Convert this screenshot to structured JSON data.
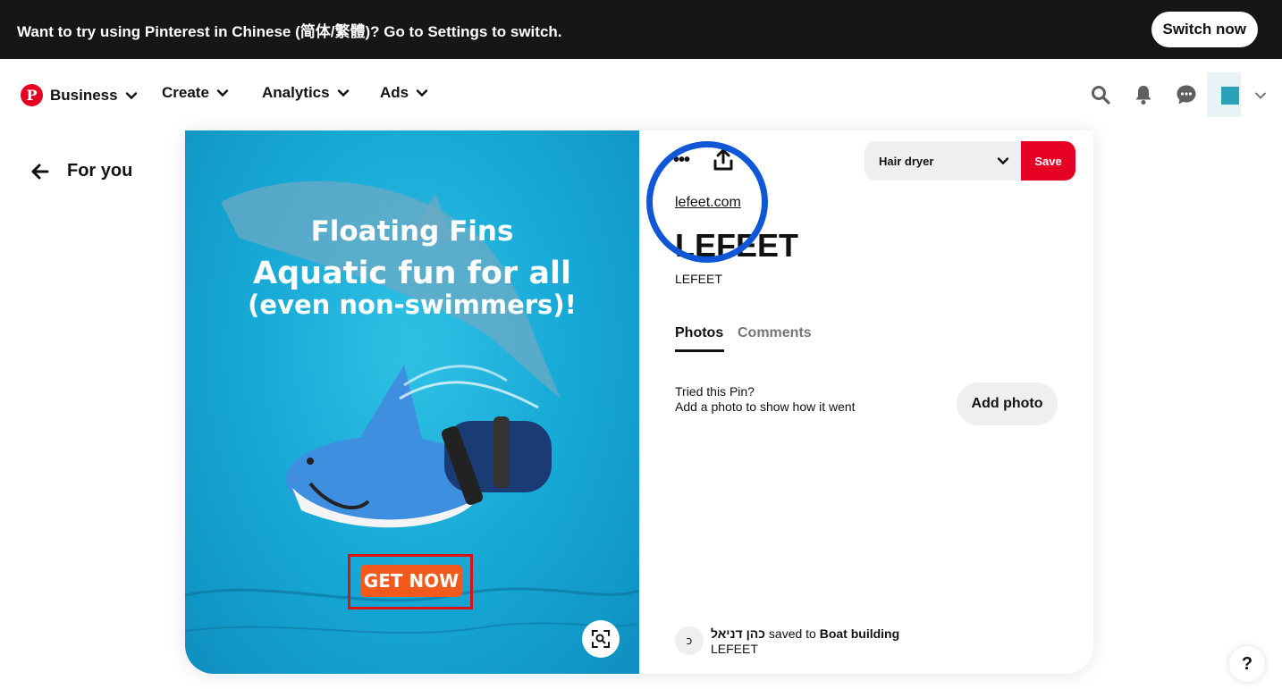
{
  "banner": {
    "text": "Want to try using Pinterest in Chinese (简体/繁體)? Go to Settings to switch.",
    "button_label": "Switch now"
  },
  "nav": {
    "logo_glyph": "P",
    "items": [
      {
        "label": "Business"
      },
      {
        "label": "Create"
      },
      {
        "label": "Analytics"
      },
      {
        "label": "Ads"
      }
    ],
    "icons": [
      "search-icon",
      "bell-icon",
      "chat-icon",
      "avatar",
      "chevron-down-icon"
    ],
    "accent_color": "#e60023"
  },
  "back": {
    "label": "For you"
  },
  "pin": {
    "image": {
      "line1": "Floating Fins",
      "line2": "Aquatic fun for all",
      "line3": "(even non-swimmers)!",
      "cta": "GET NOW"
    },
    "board_select": {
      "value": "Hair dryer"
    },
    "save_label": "Save",
    "link": "lefeet.com",
    "title": "LEFEET",
    "subtitle": "LEFEET",
    "tabs": [
      {
        "label": "Photos",
        "active": true
      },
      {
        "label": "Comments",
        "active": false
      }
    ],
    "tried": {
      "line1": "Tried this Pin?",
      "line2": "Add a photo to show how it went",
      "button_label": "Add photo"
    },
    "saver": {
      "avatar_letter": "כ",
      "name": "כהן דניאל",
      "saved_to_text": "saved to",
      "board": "Boat building",
      "source": "LEFEET"
    }
  },
  "help": {
    "label": "?"
  }
}
